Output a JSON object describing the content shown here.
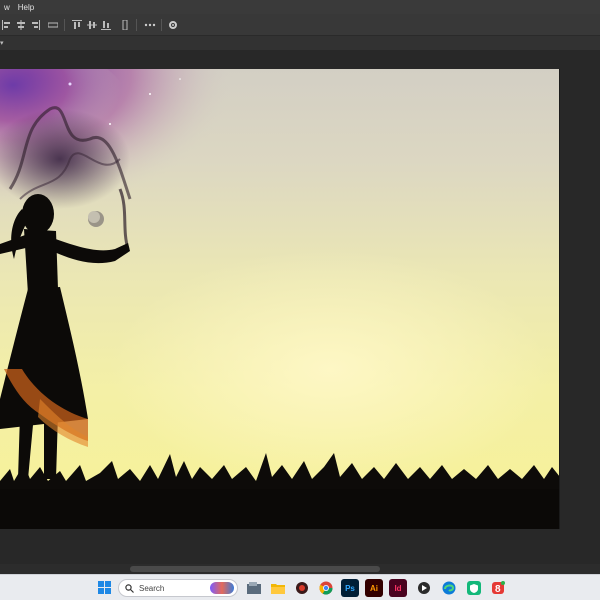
{
  "menu": {
    "items": [
      "w",
      "Help"
    ]
  },
  "options_bar": {
    "icons": [
      "align-left-icon",
      "align-center-icon",
      "align-right-icon",
      "distribute-icon",
      "align-top-icon",
      "align-middle-icon",
      "align-bottom-icon",
      "distribute-vertical-icon",
      "more-icon",
      "settings-icon"
    ]
  },
  "document_tab": {
    "label": "▾"
  },
  "taskbar": {
    "search_placeholder": "Search",
    "apps": [
      {
        "name": "windows-start-icon",
        "label": ""
      },
      {
        "name": "file-explorer-icon",
        "label": ""
      },
      {
        "name": "folder-icon",
        "label": ""
      },
      {
        "name": "app-red-icon",
        "label": ""
      },
      {
        "name": "chrome-icon",
        "label": ""
      },
      {
        "name": "photoshop-icon",
        "label": "Ps"
      },
      {
        "name": "illustrator-icon",
        "label": "Ai"
      },
      {
        "name": "indesign-icon",
        "label": "Id"
      },
      {
        "name": "media-player-icon",
        "label": ""
      },
      {
        "name": "edge-icon",
        "label": ""
      },
      {
        "name": "shield-app-icon",
        "label": ""
      },
      {
        "name": "notification-app-icon",
        "label": ""
      }
    ],
    "colors": {
      "photoshop": "#001e36",
      "illustrator": "#330000",
      "indesign": "#49021f"
    }
  }
}
